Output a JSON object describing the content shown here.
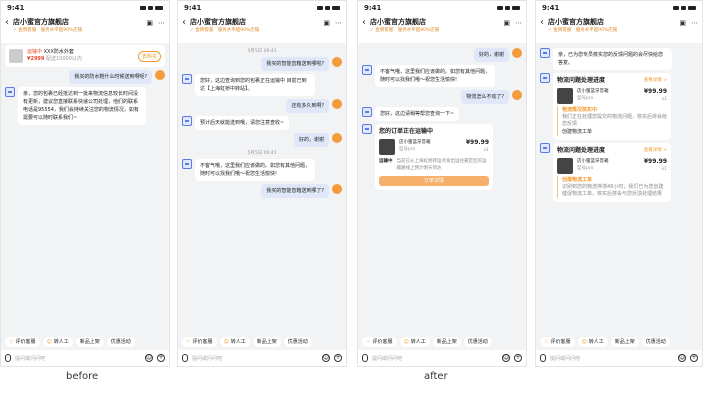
{
  "status": {
    "time": "9:41"
  },
  "nav": {
    "title": "店小蜜官方旗舰店",
    "subtitle": "✓ 金牌客服　服务水平超90%店铺"
  },
  "product": {
    "status": "运输中",
    "name": "XXX防水外套",
    "price": "¥2999",
    "extra": "配送10000以内",
    "action": "去购买"
  },
  "quick": [
    {
      "label": "评价客服"
    },
    {
      "label": "转人工"
    },
    {
      "label": "新品上架"
    },
    {
      "label": "优惠活动"
    }
  ],
  "input": {
    "placeholder": "提问或问问吧"
  },
  "captions": {
    "before": "before",
    "after": "after"
  },
  "s1": {
    "msgs": [
      {
        "text": "我买的防水鞋什么时候送到啊呢?"
      },
      {
        "text": "亲，您的包裹已经抵达到一批来物流信息较长时间没有更新，建议您直接联系快递公司处理，他们的联系电话是95554，我们会持续关注您的物流情况，如有需要可以随时联系我们~"
      }
    ]
  },
  "s2": {
    "ts1": "5月5日 09:41",
    "ts2": "5月5日 09:41",
    "msgs": [
      {
        "text": "我买的智能音箱送到哪啦?"
      },
      {
        "text": "您好，这边查询到您的包裹正在运输中 目前已到达【上海虹桥中转站】。"
      },
      {
        "text": "还有多久到啊?"
      },
      {
        "text": "预计后天就能送到哦，请您注意查收~"
      },
      {
        "text": "好的，谢谢"
      },
      {
        "text": "不客气哦，这里我们应该做的。如您有其他问题，随时可以找我们哦～祝您生活愉快!"
      },
      {
        "text": "我买的智能音箱送到哪了?"
      }
    ]
  },
  "s3": {
    "msgs": [
      {
        "text": "好的，谢谢"
      },
      {
        "text": "不客气哦，这里我们应该做的。如您有其他问题，随时可以找我们哦～祝您生活愉快!"
      },
      {
        "text": "物流怎么不动了?"
      },
      {
        "text": "您好，这边请稍等帮您查询一下~"
      }
    ],
    "card": {
      "title": "您的订单正在运输中",
      "product": "店小蜜蓝牙音箱",
      "spec": "型号pro",
      "price": "¥99.99",
      "qty": "x1",
      "state": "运输中",
      "detail": "当前已从上海虹桥转运点发出运往嘉定区的运输路线上预计明天到达",
      "button": "订单详情"
    }
  },
  "s4": {
    "top": "亲，已为您专员核实您的反馈问题的会尽快给您答复。",
    "card1": {
      "title": "物流问题处理进度",
      "link": "查看详情 >",
      "product": "店小蜜蓝牙音箱",
      "spec": "型号pro",
      "price": "¥99.99",
      "qty": "x1",
      "step1": "物流情况核实中",
      "step1b": "我们正在处理您提交的物流问题，核实后将会给您反馈",
      "step2": "创建物流工单"
    },
    "card2": {
      "title": "物流问题处理进度",
      "link": "查看详情 >",
      "product": "店小蜜蓝牙音箱",
      "spec": "型号pro",
      "price": "¥99.99",
      "qty": "x1",
      "step1": "创建物流工单",
      "step1b": "识别到您的物流停滞48小时，我们已为您创建催促物流工单，核实后将会与您反馈处理结果"
    }
  }
}
